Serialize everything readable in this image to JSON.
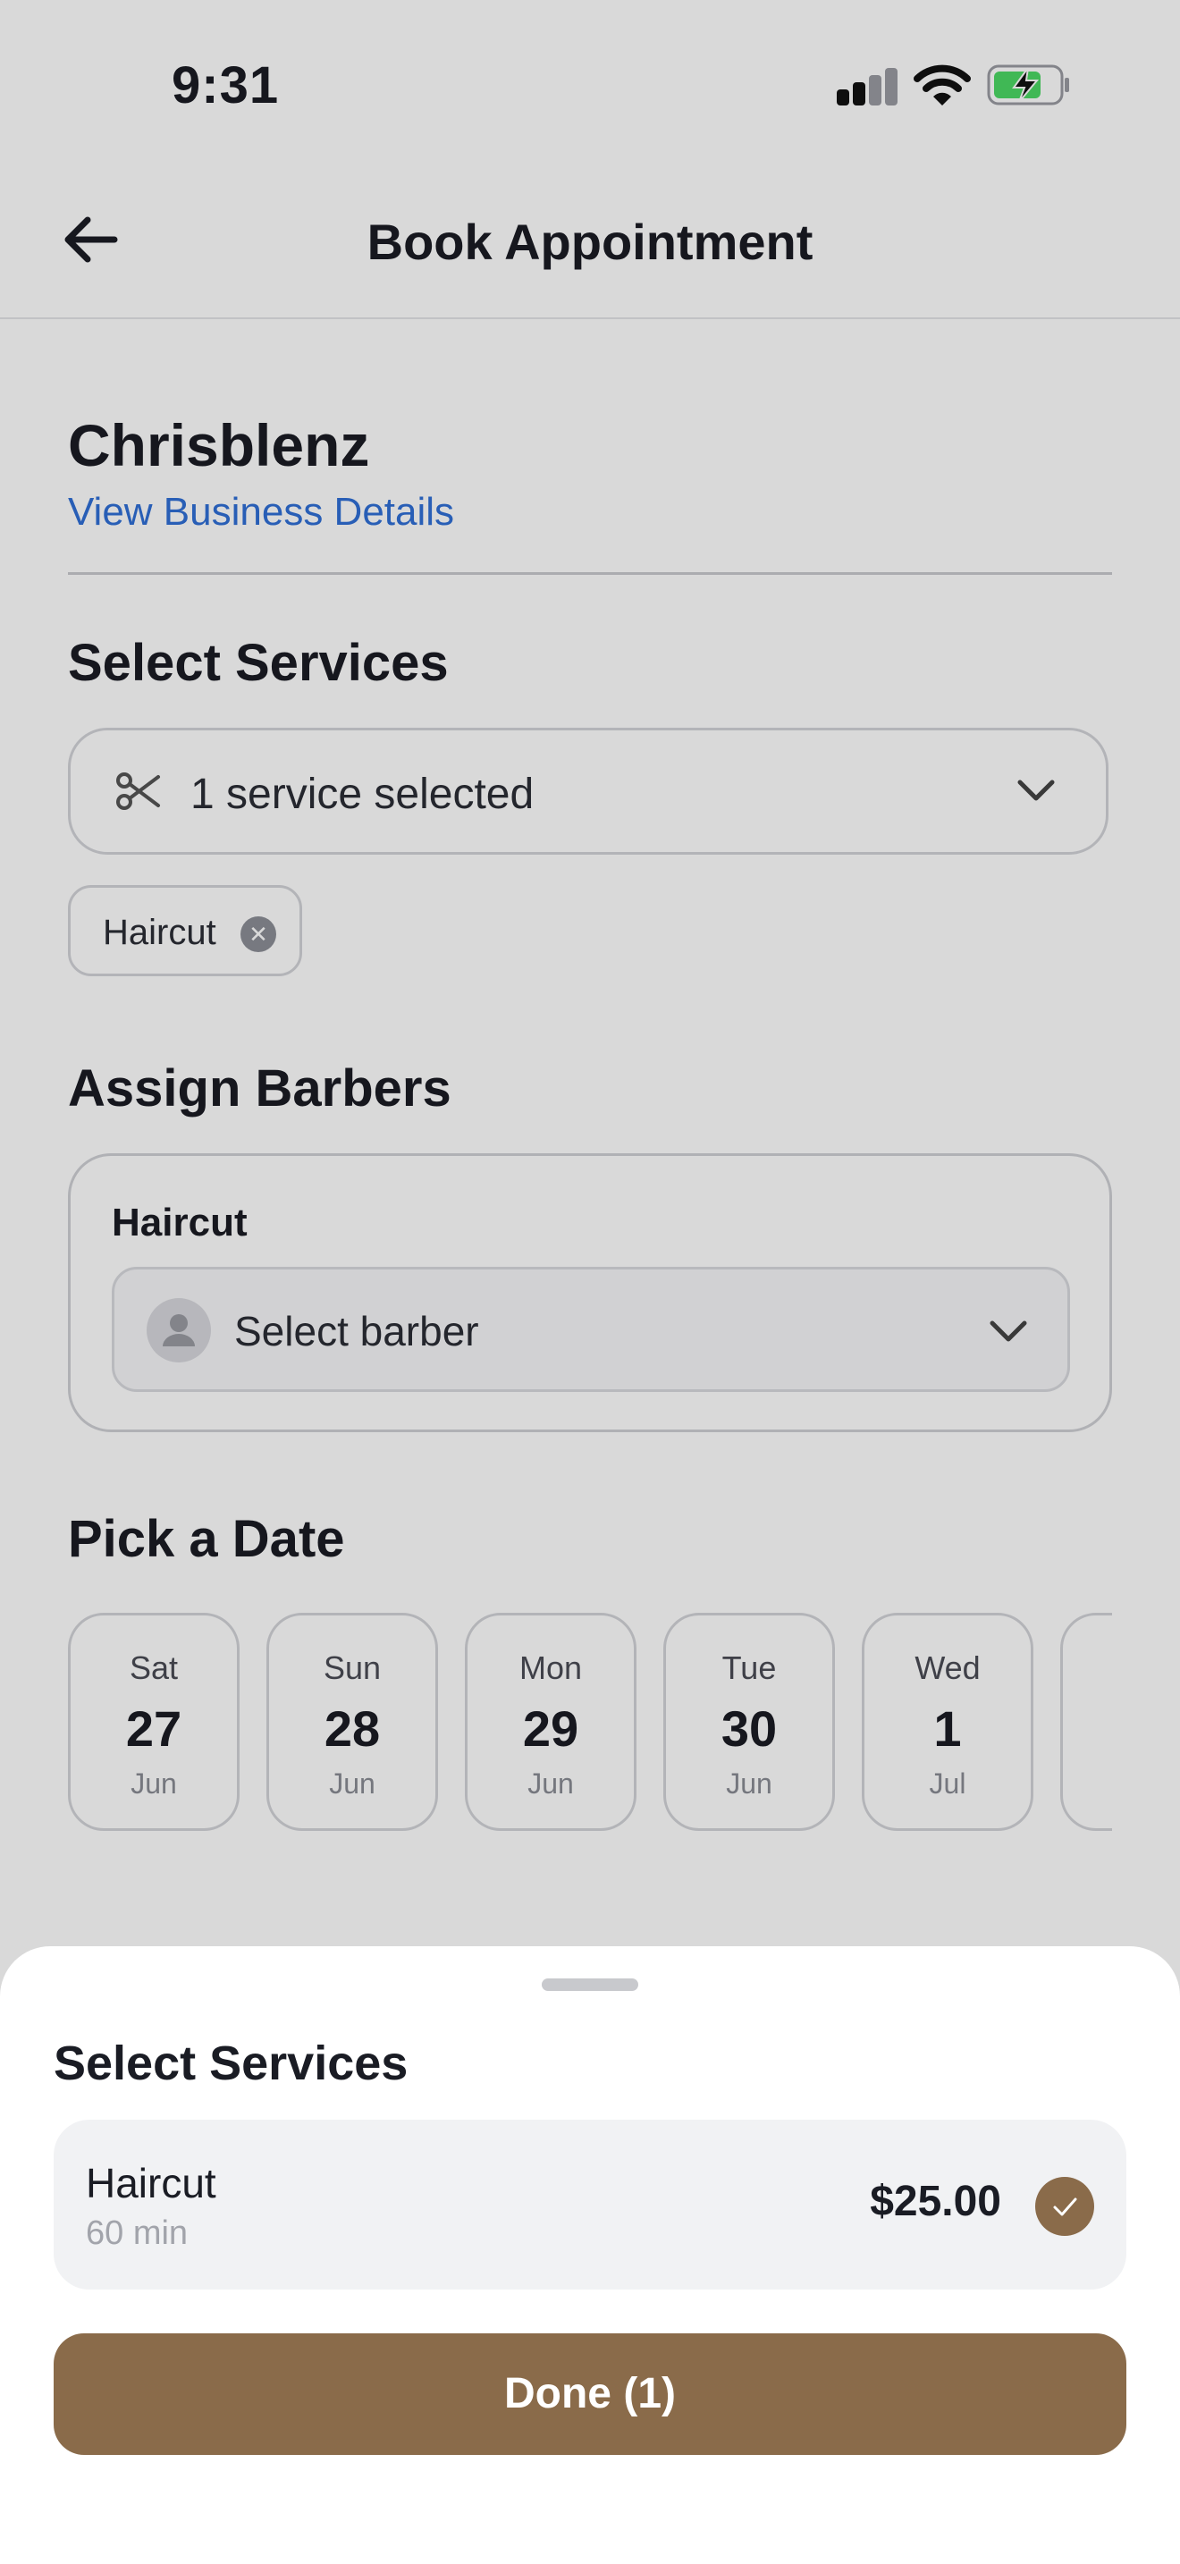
{
  "status_bar": {
    "time": "9:31"
  },
  "header": {
    "title": "Book Appointment"
  },
  "business": {
    "name": "Chrisblenz",
    "details_link": "View Business Details"
  },
  "services_section": {
    "heading": "Select Services",
    "dropdown_value": "1 service selected",
    "chips": [
      {
        "label": "Haircut"
      }
    ]
  },
  "barbers_section": {
    "heading": "Assign Barbers",
    "items": [
      {
        "service": "Haircut",
        "placeholder": "Select barber"
      }
    ]
  },
  "date_section": {
    "heading": "Pick a Date",
    "dates": [
      {
        "weekday": "Sat",
        "day": "27",
        "month": "Jun"
      },
      {
        "weekday": "Sun",
        "day": "28",
        "month": "Jun"
      },
      {
        "weekday": "Mon",
        "day": "29",
        "month": "Jun"
      },
      {
        "weekday": "Tue",
        "day": "30",
        "month": "Jun"
      },
      {
        "weekday": "Wed",
        "day": "1",
        "month": "Jul"
      }
    ]
  },
  "sheet": {
    "title": "Select Services",
    "services": [
      {
        "name": "Haircut",
        "duration": "60 min",
        "price": "$25.00",
        "selected": true
      }
    ],
    "done_button": "Done (1)"
  },
  "colors": {
    "accent": "#8a6b4a",
    "link": "#2f6fd6",
    "battery_fill": "#4cd964"
  },
  "icons": [
    "back-arrow-icon",
    "signal-icon",
    "wifi-icon",
    "battery-charging-icon",
    "scissors-icon",
    "chevron-down-icon",
    "close-icon",
    "person-icon",
    "checkmark-icon"
  ]
}
